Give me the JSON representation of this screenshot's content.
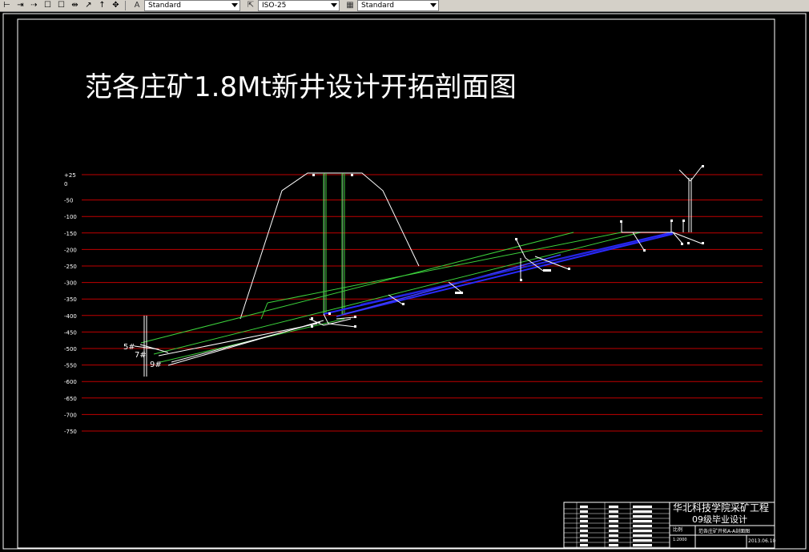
{
  "toolbar": {
    "icons": [
      "dimension-icon",
      "linear-dim-icon",
      "aligned-dim-icon",
      "box-icon",
      "box2-icon",
      "continue-dim-icon",
      "leader-icon",
      "tolerance-icon",
      "center-mark-icon"
    ],
    "style_combo_1": "Standard",
    "style_combo_2": "ISO-25",
    "style_combo_3": "Standard"
  },
  "drawing": {
    "title": "范各庄矿1.8Mt新井设计开拓剖面图",
    "elevation_labels": [
      "+25",
      "0",
      "-50",
      "-100",
      "-150",
      "-200",
      "-250",
      "-300",
      "-350",
      "-400",
      "-450",
      "-500",
      "-550",
      "-600",
      "-650",
      "-700",
      "-750"
    ],
    "elevations": [
      25,
      0,
      -50,
      -100,
      -150,
      -200,
      -250,
      -300,
      -350,
      -400,
      -450,
      -500,
      -550,
      -600,
      -650,
      -700,
      -750
    ],
    "seam_labels": [
      "5#",
      "7#",
      "9#"
    ]
  },
  "title_block": {
    "school": "华北科技学院采矿工程",
    "project": "09级毕业设计",
    "drawing_name": "范各庄矿开拓A-A剖面图",
    "scale_label": "比例",
    "scale_value": "1:2000",
    "date": "2013.06.10"
  },
  "colors": {
    "grid_line": "#c00000",
    "frame": "#ffffff",
    "seam_green": "#3cd23c",
    "roadway_blue": "#2a2aff",
    "background": "#000000"
  }
}
